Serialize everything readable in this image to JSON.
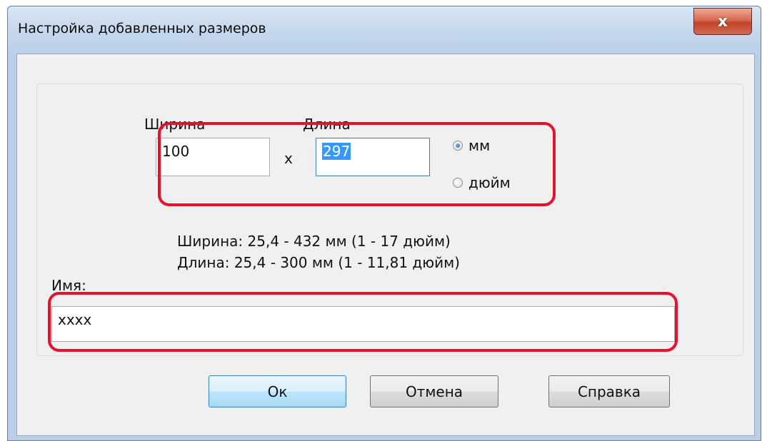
{
  "window": {
    "title": "Настройка добавленных размеров",
    "close_label": "x"
  },
  "size": {
    "width_label": "Ширина",
    "length_label": "Длина",
    "width_value": "100",
    "length_value": "297",
    "times_sign": "x",
    "units": [
      {
        "label": "мм",
        "checked": true
      },
      {
        "label": "дюйм",
        "checked": false
      }
    ]
  },
  "ranges": {
    "width": "Ширина: 25,4 - 432 мм (1 - 17 дюйм)",
    "length": "Длина: 25,4 - 300 мм (1 - 11,81 дюйм)"
  },
  "name": {
    "label": "Имя:",
    "value": "xxxx"
  },
  "buttons": {
    "ok": "Ок",
    "cancel": "Отмена",
    "help": "Справка"
  },
  "colors": {
    "highlight": "#e8112d",
    "selection": "#3399ff",
    "close_button": "#c1432a"
  }
}
